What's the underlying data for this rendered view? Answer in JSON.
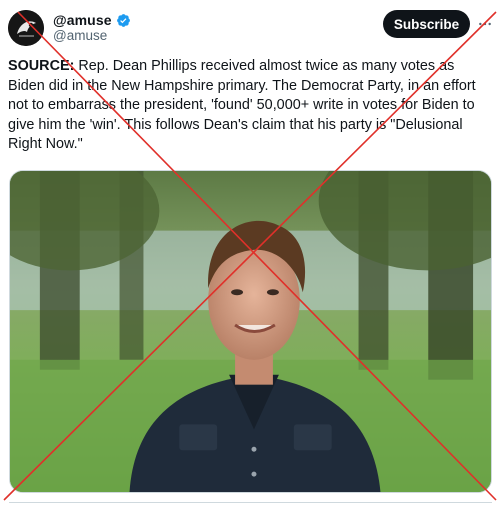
{
  "post": {
    "display_name": "@amuse",
    "handle": "@amuse",
    "subscribe_label": "Subscribe",
    "text_lead": "SOURCE:",
    "text_body": " Rep. Dean Phillips received almost twice as many votes as Biden did in the New Hampshire primary. The Democrat Party, in an effort not to embarrass the president, 'found' 50,000+ write in votes for Biden to give him the 'win'. This follows Dean's claim that his party is \"Delusional Right Now.\""
  },
  "icons": {
    "avatar": "avatar-graphic",
    "verified": "verified-badge-icon",
    "more": "more-options-icon"
  },
  "colors": {
    "verified_badge": "#1d9bf0",
    "subscribe_bg": "#0f1419",
    "handle_text": "#536471",
    "overlay_cross": "#e0302a"
  }
}
